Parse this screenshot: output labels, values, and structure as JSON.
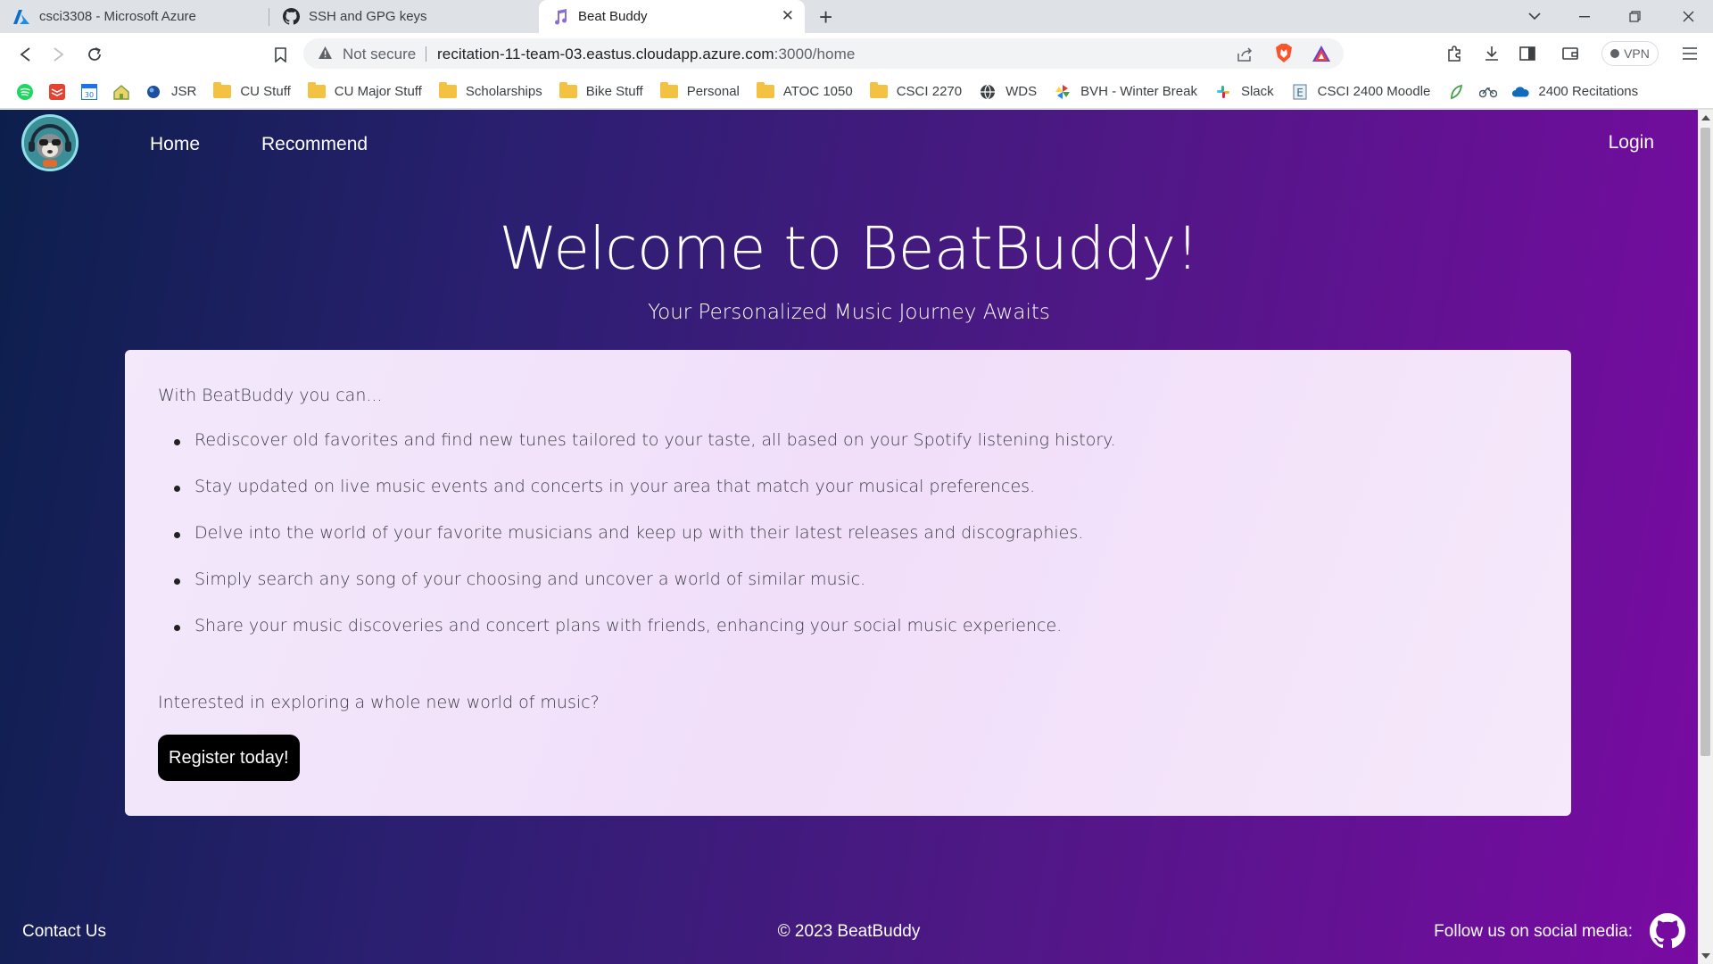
{
  "browser": {
    "tabs": [
      {
        "title": "csci3308 - Microsoft Azure",
        "icon": "azure-icon"
      },
      {
        "title": "SSH and GPG keys",
        "icon": "github-icon"
      },
      {
        "title": "Beat Buddy",
        "icon": "music-note-icon",
        "active": true
      }
    ],
    "security_label": "Not secure",
    "url_host": "recitation-11-team-03.eastus.cloudapp.azure.com",
    "url_path": ":3000/home",
    "vpn_label": "VPN"
  },
  "bookmarks": [
    {
      "label": "",
      "icon": "spotify-icon"
    },
    {
      "label": "",
      "icon": "todoist-icon"
    },
    {
      "label": "",
      "icon": "calendar-icon"
    },
    {
      "label": "",
      "icon": "house-icon"
    },
    {
      "label": "JSR",
      "icon": "globe-icon"
    },
    {
      "label": "CU Stuff",
      "icon": "folder-icon"
    },
    {
      "label": "CU Major Stuff",
      "icon": "folder-icon"
    },
    {
      "label": "Scholarships",
      "icon": "folder-icon"
    },
    {
      "label": "Bike Stuff",
      "icon": "folder-icon"
    },
    {
      "label": "Personal",
      "icon": "folder-icon"
    },
    {
      "label": "ATOC 1050",
      "icon": "folder-icon"
    },
    {
      "label": "CSCI 2270",
      "icon": "folder-icon"
    },
    {
      "label": "WDS",
      "icon": "globe-icon"
    },
    {
      "label": "BVH - Winter Break",
      "icon": "pinwheel-icon"
    },
    {
      "label": "Slack",
      "icon": "slack-icon"
    },
    {
      "label": "CSCI 2400 Moodle",
      "icon": "moodle-icon"
    },
    {
      "label": "",
      "icon": "leaf-icon"
    },
    {
      "label": "",
      "icon": "bike-icon"
    },
    {
      "label": "2400 Recitations",
      "icon": "onedrive-icon"
    }
  ],
  "site": {
    "nav": {
      "home": "Home",
      "recommend": "Recommend",
      "login": "Login"
    },
    "hero": {
      "title": "Welcome to BeatBuddy!",
      "subtitle": "Your Personalized Music Journey Awaits"
    },
    "card": {
      "intro": "With BeatBuddy you can...",
      "features": [
        "Rediscover old favorites and find new tunes tailored to your taste, all based on your Spotify listening history.",
        "Stay updated on live music events and concerts in your area that match your musical preferences.",
        "Delve into the world of your favorite musicians and keep up with their latest releases and discographies.",
        "Simply search any song of your choosing and uncover a world of similar music.",
        "Share your music discoveries and concert plans with friends, enhancing your social music experience."
      ],
      "question": "Interested in exploring a whole new world of music?",
      "cta": "Register today!"
    },
    "footer": {
      "contact": "Contact Us",
      "copyright": "© 2023 BeatBuddy",
      "follow": "Follow us on social media:"
    }
  },
  "colors": {
    "gradient_start": "#0c1f4c",
    "gradient_end": "#7a0aa3",
    "card": "#f3e6fa",
    "button": "#000000"
  }
}
